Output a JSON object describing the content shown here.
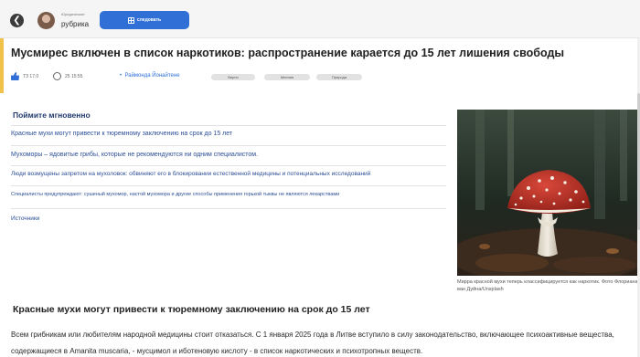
{
  "header": {
    "back_icon": "arrow-left-icon",
    "section_small": "Юридические",
    "section_name": "рубрика",
    "follow_label": "следовать",
    "follow_icon": "plus-square-icon",
    "accent_color": "#2f6fd6"
  },
  "article": {
    "title": "Мусмирес включен в список наркотиков: распространение карается до 15 лет лишения свободы",
    "date": "ТЗ 17.0",
    "time": "25 15:55",
    "author": "Раймонда Йонайтене",
    "tags": [
      "Вирно",
      "Мнения",
      "Природа"
    ]
  },
  "summary": {
    "title": "Поймите мгновенно",
    "items": [
      "Красные мухи могут привести к тюремному заключению на срок до 15 лет",
      "Мухоморы – ядовитые грибы, которые не рекомендуются ни одним специалистом.",
      "Люди возмущены запретом на мухоловок: обвиняют его в блокировании естественной медицины и потенциальных исследований",
      "Специалисты предупреждают: сушеный мухомор, настой мухомора и другие способы применения горькой тыквы не являются лекарствами"
    ],
    "sources": "Источники"
  },
  "photo": {
    "caption": "Мирра красной мухи теперь классифицируется как наркотик. Фото Флориана ван Дуйна/Unsplash"
  },
  "body": {
    "heading": "Красные мухи могут привести к тюремному заключению на срок до 15 лет",
    "paragraph": "Всем грибникам или любителям народной медицины стоит отказаться. С 1 января 2025 года в Литве вступило в силу законодательство, включающее психоактивные вещества, содержащиеся в Amanita muscaria, - мусцимол и иботеновую кислоту - в список наркотических и психотропных веществ."
  }
}
